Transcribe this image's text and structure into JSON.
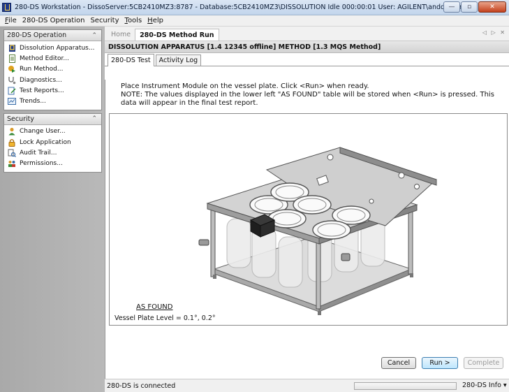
{
  "window": {
    "title": "280-DS Workstation - DissoServer:5CB2410MZ3:8787 - Database:5CB2410MZ3\\DISSOLUTION   Idle 000:00:01  User: AGILENT\\anddamon",
    "minimize": "—",
    "maximize": "▫",
    "close": "✕"
  },
  "menu": [
    {
      "ul": "F",
      "rest": "ile"
    },
    {
      "ul": "",
      "rest": "280-DS Operation"
    },
    {
      "ul": "",
      "rest": "Security"
    },
    {
      "ul": "T",
      "rest": "ools"
    },
    {
      "ul": "H",
      "rest": "elp"
    }
  ],
  "sidebar": {
    "operation": {
      "header": "280-DS Operation",
      "chevron": "⌃",
      "items": [
        {
          "label": "Dissolution Apparatus..."
        },
        {
          "label": "Method Editor..."
        },
        {
          "label": "Run Method..."
        },
        {
          "label": "Diagnostics..."
        },
        {
          "label": "Test Reports..."
        },
        {
          "label": "Trends..."
        }
      ]
    },
    "security": {
      "header": "Security",
      "chevron": "⌃",
      "items": [
        {
          "label": "Change User..."
        },
        {
          "label": "Lock Application"
        },
        {
          "label": "Audit Trail..."
        },
        {
          "label": "Permissions..."
        }
      ]
    }
  },
  "doc_tabs": {
    "home": "Home",
    "active": "280-DS Method Run",
    "nav": "◁ ▷ ✕"
  },
  "header": "DISSOLUTION APPARATUS [1.4 12345 offline] METHOD [1.3 MQS Method]",
  "sub_tabs": {
    "test": "280-DS Test",
    "log": "Activity Log"
  },
  "instructions": {
    "line1": "Place Instrument Module on the vessel plate. Click <Run> when ready.",
    "line2": "NOTE: The values displayed in the lower left \"AS FOUND\" table will be stored when <Run> is pressed. This data will appear in the final test report."
  },
  "as_found": {
    "heading": "AS FOUND",
    "vessel_plate": "Vessel Plate Level = 0.1°, 0.2°"
  },
  "buttons": {
    "cancel": "Cancel",
    "run": "Run >",
    "complete": "Complete"
  },
  "status": {
    "text": "280-DS is connected",
    "info": "280-DS Info ▾"
  }
}
